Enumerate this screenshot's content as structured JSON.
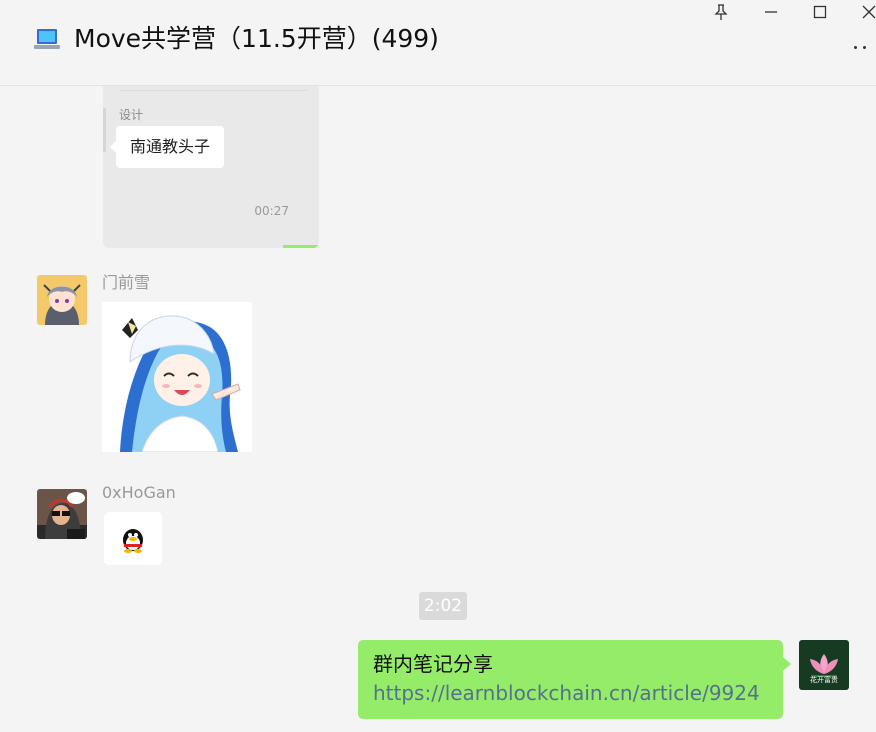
{
  "window": {
    "title": "Move共学营（11.5开营）(499)",
    "icon": "laptop-icon",
    "controls": [
      "pin-icon",
      "minimize-icon",
      "maximize-icon",
      "close-icon"
    ],
    "more_icon": "more-icon"
  },
  "messages": {
    "forwarded_card": {
      "sender": "设计",
      "text": "南通教头子",
      "time": "00:27"
    },
    "msg1": {
      "nickname": "门前雪",
      "avatar": "anime-avatar",
      "content": "anime-sticker"
    },
    "msg2": {
      "nickname": "0xHoGan",
      "avatar": "hacker-avatar",
      "content": "qq-penguin-emoji"
    },
    "time_divider": "2:02",
    "self_message": {
      "text": "群内笔记分享",
      "link": "https://learnblockchain.cn/article/9924",
      "avatar": "lotus-avatar",
      "avatar_caption": "花开富贵"
    }
  },
  "colors": {
    "background": "#f4f4f4",
    "self_bubble": "#95ec69",
    "link": "#56708f",
    "nickname": "#999999"
  }
}
